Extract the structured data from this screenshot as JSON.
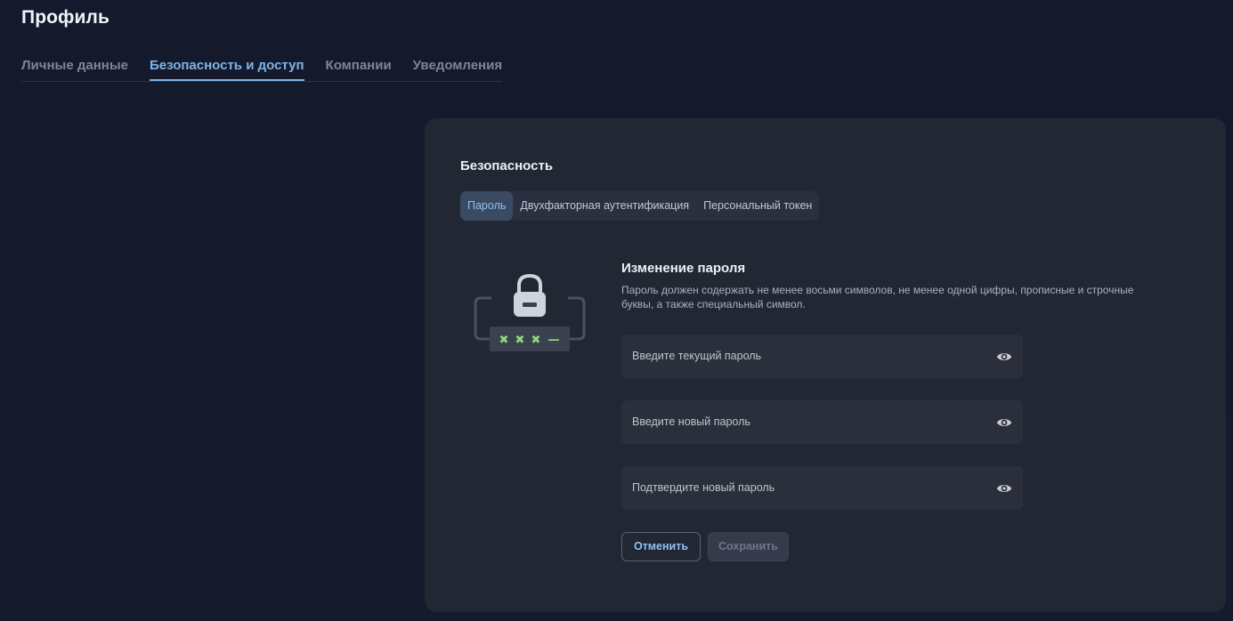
{
  "page": {
    "title": "Профиль"
  },
  "top_tabs": [
    {
      "label": "Личные данные",
      "active": false
    },
    {
      "label": "Безопасность и доступ",
      "active": true
    },
    {
      "label": "Компании",
      "active": false
    },
    {
      "label": "Уведомления",
      "active": false
    }
  ],
  "security": {
    "title": "Безопасность",
    "tabs": [
      {
        "label": "Пароль",
        "active": true
      },
      {
        "label": "Двухфакторная аутентификация",
        "active": false
      },
      {
        "label": "Персональный токен",
        "active": false
      }
    ]
  },
  "illustration": {
    "icon": "lock-icon",
    "mask_glyphs": [
      "✖",
      "✖",
      "✖",
      "—"
    ],
    "mask_color": "#8fd97a"
  },
  "password_form": {
    "title": "Изменение пароля",
    "description": "Пароль должен содержать не менее восьми символов, не менее одной цифры, прописные и строчные буквы, а также специальный символ.",
    "fields": [
      {
        "placeholder": "Введите текущий пароль",
        "value": "",
        "icon": "eye-icon"
      },
      {
        "placeholder": "Введите новый пароль",
        "value": "",
        "icon": "eye-icon"
      },
      {
        "placeholder": "Подтвердите новый пароль",
        "value": "",
        "icon": "eye-icon"
      }
    ],
    "cancel_label": "Отменить",
    "save_label": "Сохранить"
  },
  "colors": {
    "background": "#141a2b",
    "card": "#222734",
    "accent": "#7fb3e6",
    "field": "#2b2f3c"
  }
}
